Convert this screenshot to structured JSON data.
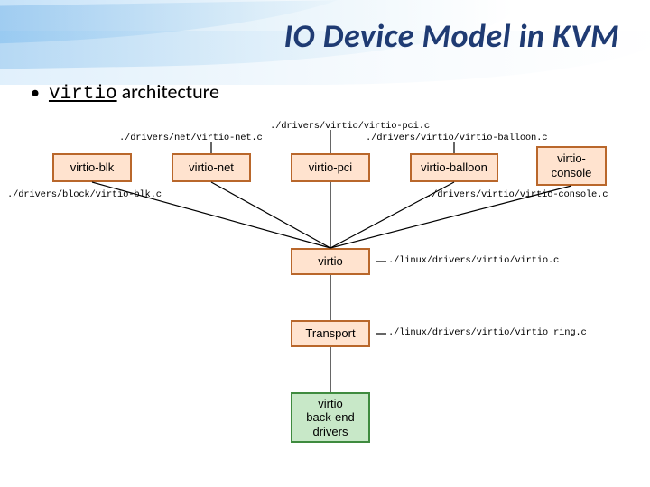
{
  "slide": {
    "title": "IO Device Model in KVM",
    "bullet_code": "virtio",
    "bullet_rest": " architecture"
  },
  "nodes": {
    "blk": {
      "label": "virtio-blk",
      "path": "./drivers/block/virtio-blk.c"
    },
    "net": {
      "label": "virtio-net",
      "path": "./drivers/net/virtio-net.c"
    },
    "pci": {
      "label": "virtio-pci",
      "path": "./drivers/virtio/virtio-pci.c"
    },
    "balloon": {
      "label": "virtio-balloon",
      "path": "./drivers/virtio/virtio-balloon.c"
    },
    "console": {
      "label": "virtio-\nconsole",
      "path": "./drivers/virtio/virtio-console.c"
    },
    "virtio": {
      "label": "virtio",
      "path": "./linux/drivers/virtio/virtio.c"
    },
    "transport": {
      "label": "Transport",
      "path": "./linux/drivers/virtio/virtio_ring.c"
    },
    "backend": {
      "label": "virtio\nback-end\ndrivers"
    }
  }
}
